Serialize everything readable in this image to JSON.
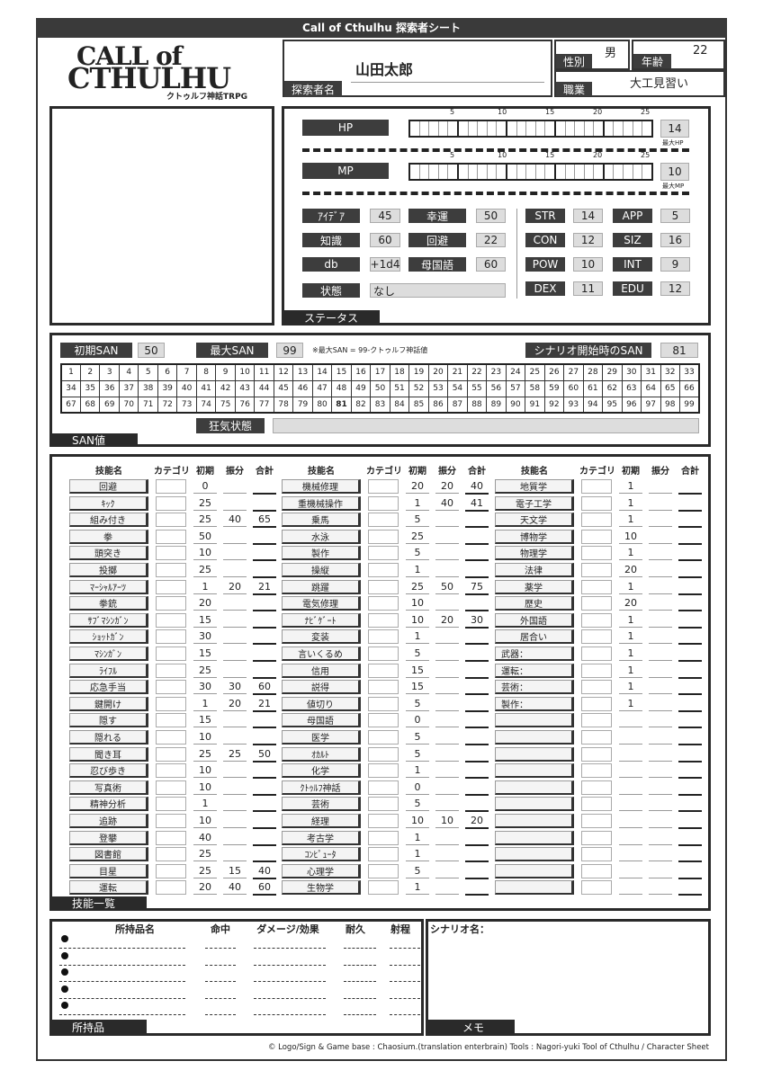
{
  "title": "Call of Cthulhu 探索者シート",
  "logo": {
    "line1": "CALL of",
    "line2": "CTHULHU",
    "sub": "クトゥルフ神話TRPG"
  },
  "profile": {
    "name_label": "探索者名",
    "name": "山田太郎",
    "sex_label": "性別",
    "sex": "男",
    "age_label": "年齢",
    "age": "22",
    "job_label": "職業",
    "job": "大工見習い"
  },
  "status": {
    "tab": "ステータス",
    "hp_label": "HP",
    "hp": "14",
    "max_hp_label": "最大HP",
    "mp_label": "MP",
    "mp": "10",
    "max_mp_label": "最大MP",
    "ticks": [
      "5",
      "10",
      "15",
      "20",
      "25"
    ],
    "left": [
      [
        "ｱｲﾃﾞｱ",
        "45",
        "幸運",
        "50"
      ],
      [
        "知識",
        "60",
        "回避",
        "22"
      ],
      [
        "db",
        "+1d4",
        "母国語",
        "60"
      ]
    ],
    "cond_label": "状態",
    "cond": "なし",
    "attrs": [
      [
        "STR",
        "14",
        "APP",
        "5"
      ],
      [
        "CON",
        "12",
        "SIZ",
        "16"
      ],
      [
        "POW",
        "10",
        "INT",
        "9"
      ],
      [
        "DEX",
        "11",
        "EDU",
        "12"
      ]
    ]
  },
  "san": {
    "tab": "SAN値",
    "initial_label": "初期SAN",
    "initial": "50",
    "max_label": "最大SAN",
    "max": "99",
    "note": "※最大SAN = 99-クトゥルフ神話値",
    "start_label": "シナリオ開始時のSAN",
    "start": "81",
    "current": 81,
    "madness_label": "狂気状態",
    "madness": ""
  },
  "skills": {
    "tab": "技能一覧",
    "headers": [
      "技能名",
      "カテゴリ",
      "初期",
      "振分",
      "合計"
    ],
    "columns": [
      [
        [
          "回避",
          "0",
          "",
          ""
        ],
        [
          "ｷｯｸ",
          "25",
          "",
          ""
        ],
        [
          "組み付き",
          "25",
          "40",
          "65"
        ],
        [
          "拳",
          "50",
          "",
          ""
        ],
        [
          "頭突き",
          "10",
          "",
          ""
        ],
        [
          "投擲",
          "25",
          "",
          ""
        ],
        [
          "ﾏｰｼｬﾙｱｰﾂ",
          "1",
          "20",
          "21"
        ],
        [
          "拳銃",
          "20",
          "",
          ""
        ],
        [
          "ｻﾌﾞﾏｼﾝｶﾞﾝ",
          "15",
          "",
          ""
        ],
        [
          "ｼｮｯﾄｶﾞﾝ",
          "30",
          "",
          ""
        ],
        [
          "ﾏｼﾝｶﾞﾝ",
          "15",
          "",
          ""
        ],
        [
          "ﾗｲﾌﾙ",
          "25",
          "",
          ""
        ],
        [
          "応急手当",
          "30",
          "30",
          "60"
        ],
        [
          "鍵開け",
          "1",
          "20",
          "21"
        ],
        [
          "隠す",
          "15",
          "",
          ""
        ],
        [
          "隠れる",
          "10",
          "",
          ""
        ],
        [
          "聞き耳",
          "25",
          "25",
          "50"
        ],
        [
          "忍び歩き",
          "10",
          "",
          ""
        ],
        [
          "写真術",
          "10",
          "",
          ""
        ],
        [
          "精神分析",
          "1",
          "",
          ""
        ],
        [
          "追跡",
          "10",
          "",
          ""
        ],
        [
          "登攀",
          "40",
          "",
          ""
        ],
        [
          "図書館",
          "25",
          "",
          ""
        ],
        [
          "目星",
          "25",
          "15",
          "40"
        ],
        [
          "運転",
          "20",
          "40",
          "60"
        ]
      ],
      [
        [
          "機械修理",
          "20",
          "20",
          "40"
        ],
        [
          "重機械操作",
          "1",
          "40",
          "41"
        ],
        [
          "乗馬",
          "5",
          "",
          ""
        ],
        [
          "水泳",
          "25",
          "",
          ""
        ],
        [
          "製作",
          "5",
          "",
          ""
        ],
        [
          "操縦",
          "1",
          "",
          ""
        ],
        [
          "跳躍",
          "25",
          "50",
          "75"
        ],
        [
          "電気修理",
          "10",
          "",
          ""
        ],
        [
          "ﾅﾋﾞｹﾞｰﾄ",
          "10",
          "20",
          "30"
        ],
        [
          "変装",
          "1",
          "",
          ""
        ],
        [
          "言いくるめ",
          "5",
          "",
          ""
        ],
        [
          "信用",
          "15",
          "",
          ""
        ],
        [
          "説得",
          "15",
          "",
          ""
        ],
        [
          "値切り",
          "5",
          "",
          ""
        ],
        [
          "母国語",
          "0",
          "",
          ""
        ],
        [
          "医学",
          "5",
          "",
          ""
        ],
        [
          "ｵｶﾙﾄ",
          "5",
          "",
          ""
        ],
        [
          "化学",
          "1",
          "",
          ""
        ],
        [
          "ｸﾄｩﾙﾌ神話",
          "0",
          "",
          ""
        ],
        [
          "芸術",
          "5",
          "",
          ""
        ],
        [
          "経理",
          "10",
          "10",
          "20"
        ],
        [
          "考古学",
          "1",
          "",
          ""
        ],
        [
          "ｺﾝﾋﾟｭｰﾀ",
          "1",
          "",
          ""
        ],
        [
          "心理学",
          "5",
          "",
          ""
        ],
        [
          "生物学",
          "1",
          "",
          ""
        ]
      ],
      [
        [
          "地質学",
          "1",
          "",
          ""
        ],
        [
          "電子工学",
          "1",
          "",
          ""
        ],
        [
          "天文学",
          "1",
          "",
          ""
        ],
        [
          "博物学",
          "10",
          "",
          ""
        ],
        [
          "物理学",
          "1",
          "",
          ""
        ],
        [
          "法律",
          "20",
          "",
          ""
        ],
        [
          "薬学",
          "1",
          "",
          ""
        ],
        [
          "歴史",
          "20",
          "",
          ""
        ],
        [
          "外国語",
          "1",
          "",
          ""
        ],
        [
          "居合い",
          "1",
          "",
          ""
        ],
        [
          "武器：",
          "1",
          "",
          ""
        ],
        [
          "運転：",
          "1",
          "",
          ""
        ],
        [
          "芸術：",
          "1",
          "",
          ""
        ],
        [
          "製作：",
          "1",
          "",
          ""
        ],
        [
          "",
          "",
          "",
          ""
        ],
        [
          "",
          "",
          "",
          ""
        ],
        [
          "",
          "",
          "",
          ""
        ],
        [
          "",
          "",
          "",
          ""
        ],
        [
          "",
          "",
          "",
          ""
        ],
        [
          "",
          "",
          "",
          ""
        ],
        [
          "",
          "",
          "",
          ""
        ],
        [
          "",
          "",
          "",
          ""
        ],
        [
          "",
          "",
          "",
          ""
        ],
        [
          "",
          "",
          "",
          ""
        ],
        [
          "",
          "",
          "",
          ""
        ]
      ]
    ]
  },
  "items": {
    "tab": "所持品",
    "headers": [
      "所持品名",
      "命中",
      "ダメージ/効果",
      "耐久",
      "射程"
    ],
    "rows": 5
  },
  "memo": {
    "tab": "メモ",
    "scenario_label": "シナリオ名："
  },
  "footer": "© Logo/Sign & Game base : Chaosium.(translation enterbrain)  Tools : Nagori-yuki   Tool of Cthulhu  / Character Sheet"
}
